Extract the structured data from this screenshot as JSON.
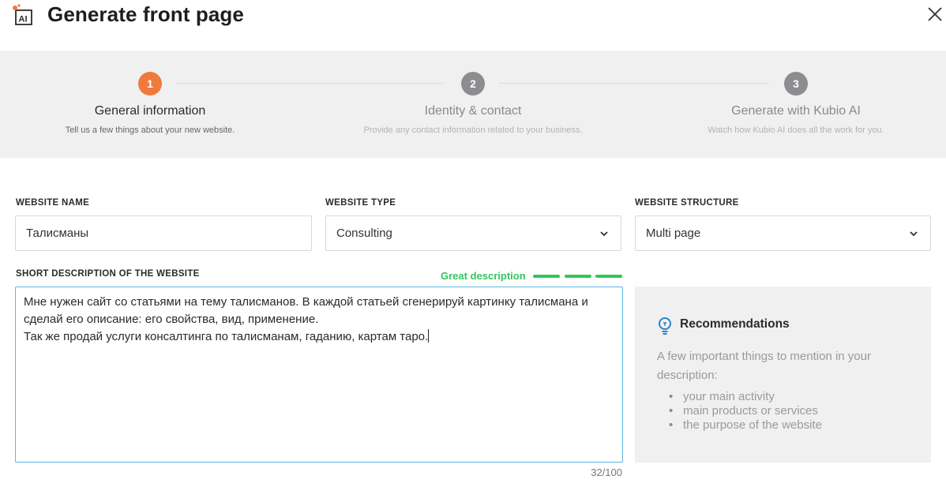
{
  "header": {
    "logo_text": "AI",
    "title": "Generate front page",
    "close_icon": "close-icon"
  },
  "colors": {
    "active_step": "#f07a3e",
    "inactive_step": "#8d8d91",
    "quality_green": "#34c759",
    "textarea_border": "#5fb5e0",
    "stepper_bg": "#f0f0f0"
  },
  "stepper": {
    "steps": [
      {
        "number": "1",
        "title": "General information",
        "subtitle": "Tell us a few things about your new website.",
        "active": true
      },
      {
        "number": "2",
        "title": "Identity & contact",
        "subtitle": "Provide any contact information related to your business.",
        "active": false
      },
      {
        "number": "3",
        "title": "Generate with Kubio AI",
        "subtitle": "Watch how Kubio AI does all the work for you.",
        "active": false
      }
    ]
  },
  "form": {
    "website_name": {
      "label": "WEBSITE NAME",
      "value": "Талисманы"
    },
    "website_type": {
      "label": "WEBSITE TYPE",
      "value": "Consulting",
      "icon": "chevron-down-icon"
    },
    "website_structure": {
      "label": "WEBSITE STRUCTURE",
      "value": "Multi page",
      "icon": "chevron-down-icon"
    },
    "description": {
      "label": "SHORT DESCRIPTION OF THE WEBSITE",
      "quality_label": "Great description",
      "quality_level": 3,
      "quality_max": 3,
      "lines": [
        "Мне нужен сайт со статьями на тему талисманов. В каждой статьей сгенерируй картинку талисмана и",
        "сделай его описание: его свойства, вид, применение.",
        "Так же продай услуги консалтинга по талисманам, гаданию, картам таро."
      ],
      "counter": "32/100"
    }
  },
  "recommendations": {
    "icon": "lightbulb-icon",
    "title": "Recommendations",
    "text": "A few important things to mention in your description:",
    "items": [
      "your main activity",
      "main products or services",
      "the purpose of the website"
    ]
  }
}
